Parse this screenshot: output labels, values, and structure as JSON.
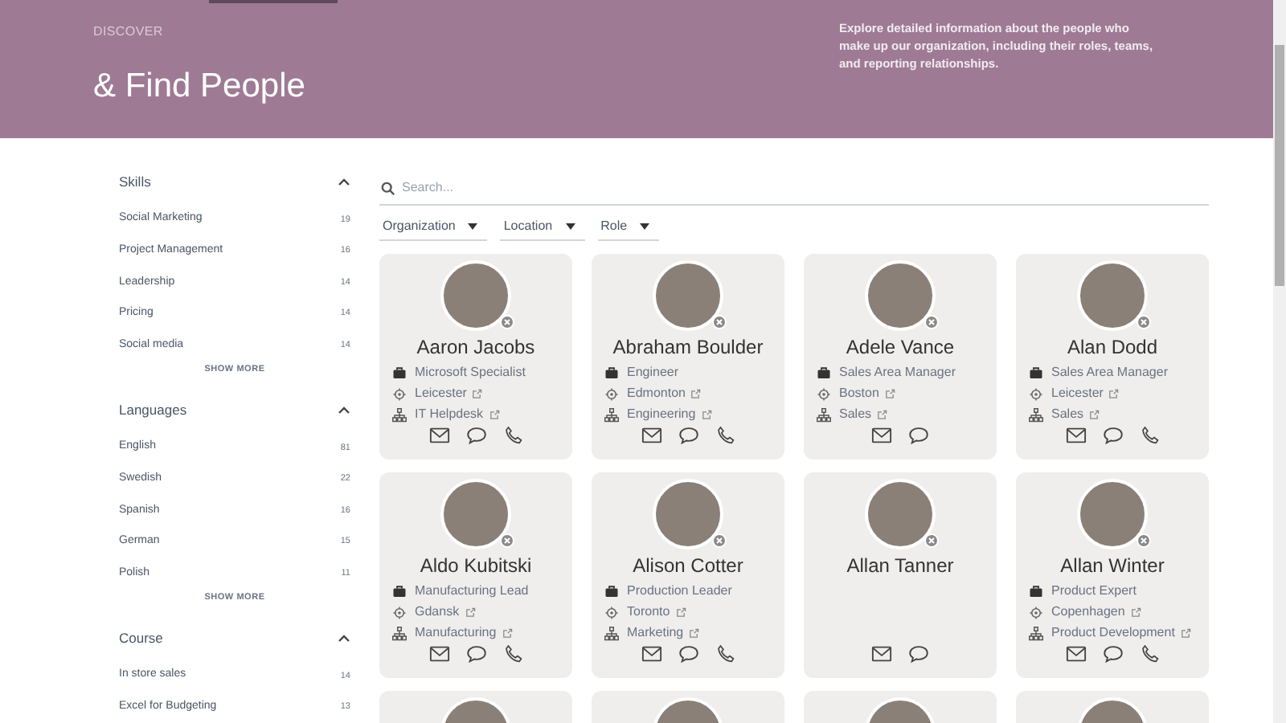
{
  "header": {
    "eyebrow": "DISCOVER",
    "title": "& Find People",
    "description": "Explore detailed information about the people who make up our organization, including their roles, teams, and reporting relationships."
  },
  "filters_sidebar": [
    {
      "title": "Skills",
      "expanded": true,
      "items": [
        {
          "label": "Social Marketing",
          "count": "19"
        },
        {
          "label": "Project Management",
          "count": "16"
        },
        {
          "label": "Leadership",
          "count": "14"
        },
        {
          "label": "Pricing",
          "count": "14"
        },
        {
          "label": "Social media",
          "count": "14"
        }
      ],
      "show_more": "SHOW MORE"
    },
    {
      "title": "Languages",
      "expanded": true,
      "items": [
        {
          "label": "English",
          "count": "81"
        },
        {
          "label": "Swedish",
          "count": "22"
        },
        {
          "label": "Spanish",
          "count": "16"
        },
        {
          "label": "German",
          "count": "15"
        },
        {
          "label": "Polish",
          "count": "11"
        }
      ],
      "show_more": "SHOW MORE"
    },
    {
      "title": "Course",
      "expanded": true,
      "items": [
        {
          "label": "In store sales",
          "count": "14"
        },
        {
          "label": "Excel for Budgeting",
          "count": "13"
        }
      ]
    }
  ],
  "search": {
    "placeholder": "Search..."
  },
  "dropdowns": [
    "Organization",
    "Location",
    "Role"
  ],
  "people": [
    {
      "photo": true,
      "offline": true,
      "name": "Aaron Jacobs",
      "job_title": "Microsoft Specialist",
      "location": "Leicester",
      "department": "IT Helpdesk",
      "email": true,
      "chat": true,
      "phone": true
    },
    {
      "photo": true,
      "offline": true,
      "name": "Abraham Boulder",
      "job_title": "Engineer",
      "location": "Edmonton",
      "department": "Engineering",
      "email": true,
      "chat": true,
      "phone": true
    },
    {
      "photo": true,
      "offline": true,
      "name": "Adele Vance",
      "job_title": "Sales Area Manager",
      "location": "Boston",
      "department": "Sales",
      "email": true,
      "chat": true,
      "phone": false
    },
    {
      "photo": true,
      "offline": true,
      "name": "Alan Dodd",
      "job_title": "Sales Area Manager",
      "location": "Leicester",
      "department": "Sales",
      "email": true,
      "chat": true,
      "phone": true
    },
    {
      "photo": true,
      "offline": true,
      "name": "Aldo Kubitski",
      "job_title": "Manufacturing Lead",
      "location": "Gdansk",
      "department": "Manufacturing",
      "email": true,
      "chat": true,
      "phone": true
    },
    {
      "photo": true,
      "offline": true,
      "name": "Alison Cotter",
      "job_title": "Production Leader",
      "location": "Toronto",
      "department": "Marketing",
      "email": true,
      "chat": true,
      "phone": true
    },
    {
      "photo": true,
      "offline": true,
      "name": "Allan Tanner",
      "email": true,
      "chat": true,
      "phone": false
    },
    {
      "photo": true,
      "offline": true,
      "name": "Allan Winter",
      "job_title": "Product Expert",
      "location": "Copenhagen",
      "department": "Product Development",
      "email": true,
      "chat": true,
      "phone": true
    },
    {
      "photo": true
    },
    {
      "photo": true
    },
    {
      "photo": true
    },
    {
      "photo": true
    }
  ]
}
